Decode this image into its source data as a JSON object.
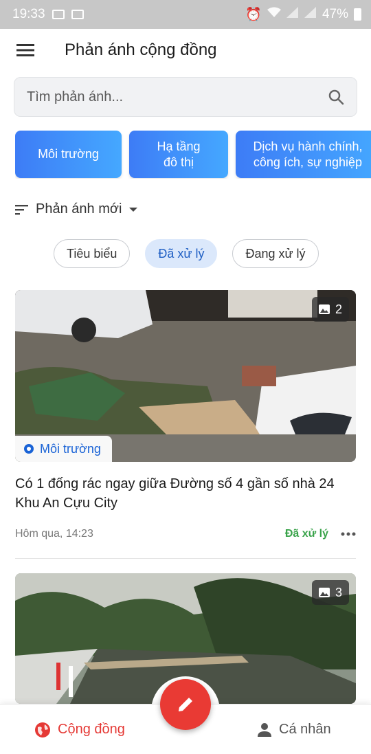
{
  "status_bar": {
    "time": "19:33",
    "battery": "47%"
  },
  "header": {
    "title": "Phản ánh cộng đồng"
  },
  "search": {
    "placeholder": "Tìm phản ánh..."
  },
  "categories": [
    {
      "label": "Môi trường"
    },
    {
      "label": "Hạ tầng\nđô thị"
    },
    {
      "label": "Dịch vụ hành chính,\ncông ích, sự nghiệp"
    }
  ],
  "sort": {
    "label": "Phản ánh mới"
  },
  "filters": [
    {
      "label": "Tiêu biểu"
    },
    {
      "label": "Đã xử lý"
    },
    {
      "label": "Đang xử lý"
    }
  ],
  "posts": [
    {
      "image_count": "2",
      "category": "Môi trường",
      "title": "Có 1 đống rác ngay giữa Đường số 4 gần số nhà 24 Khu An Cựu City",
      "time": "Hôm qua, 14:23",
      "status": "Đã xử lý"
    },
    {
      "image_count": "3"
    }
  ],
  "bottom_nav": {
    "community": "Cộng đồng",
    "profile": "Cá nhân"
  },
  "colors": {
    "accent": "#3d7cf6",
    "fab": "#e93a34",
    "status_done": "#39a34a",
    "nav_active": "#e53935"
  }
}
